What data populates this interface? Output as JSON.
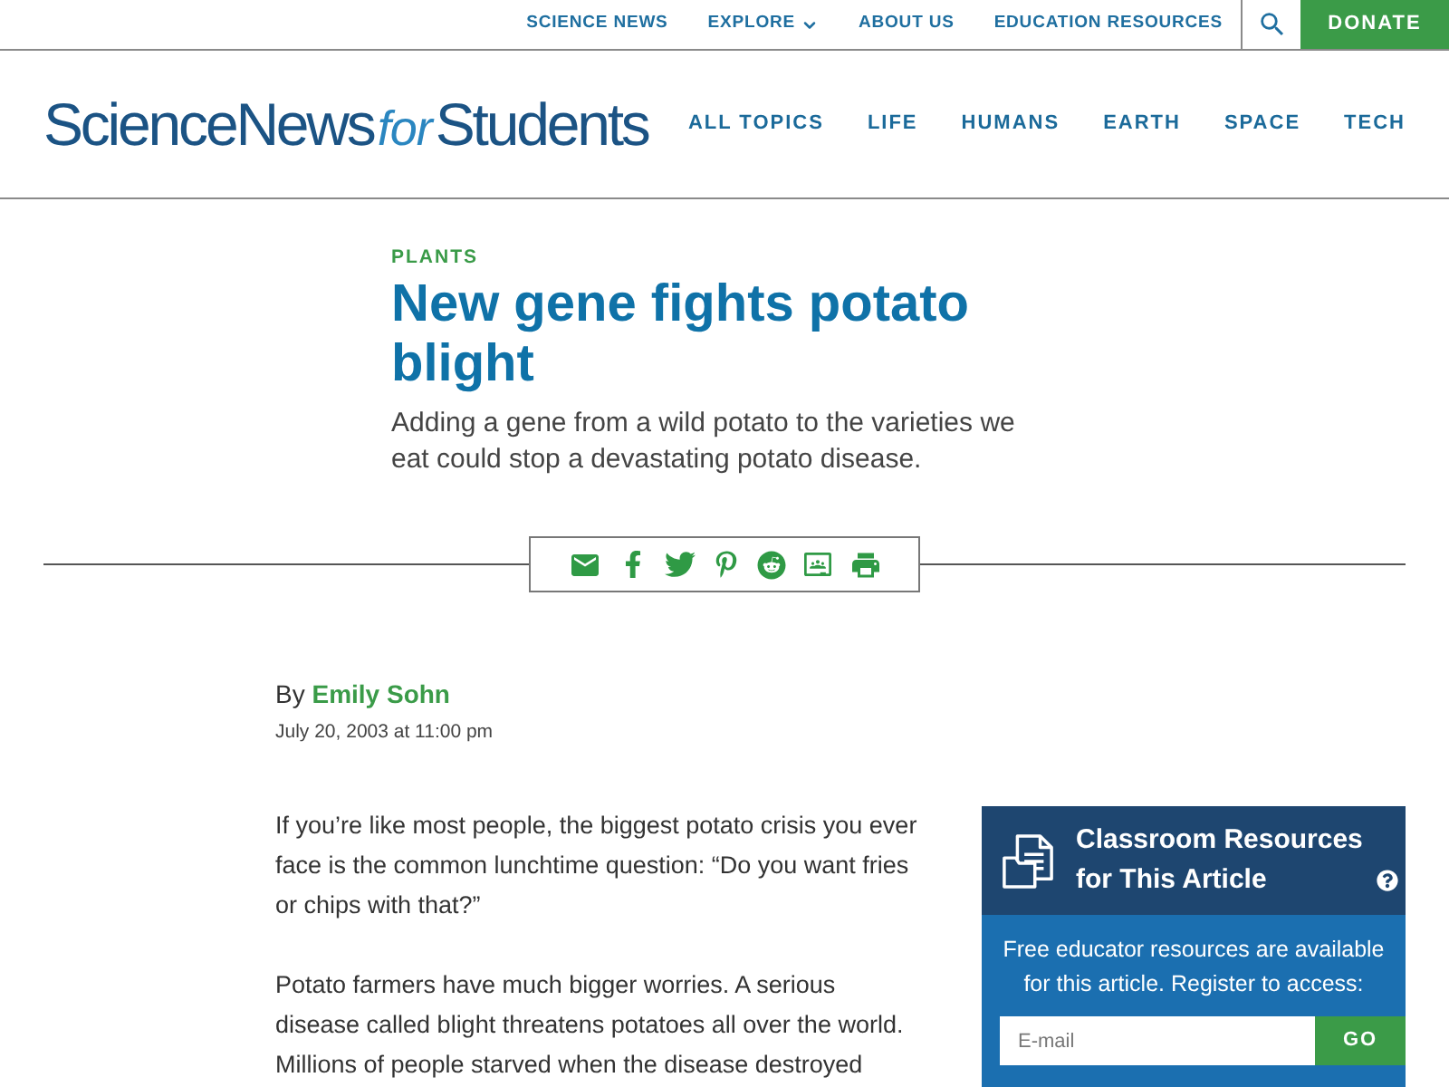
{
  "top_nav": {
    "links": [
      {
        "label": "SCIENCE NEWS",
        "kind": "link"
      },
      {
        "label": "EXPLORE",
        "kind": "dropdown"
      },
      {
        "label": "ABOUT US",
        "kind": "link"
      },
      {
        "label": "EDUCATION RESOURCES",
        "kind": "link"
      }
    ],
    "donate_button": "DONATE"
  },
  "header": {
    "logo": [
      {
        "text": "ScienceNews",
        "kind": "plain"
      },
      {
        "text": "for",
        "kind": "italic"
      },
      {
        "text": "Students",
        "kind": "plain"
      }
    ],
    "nav": [
      "ALL TOPICS",
      "LIFE",
      "HUMANS",
      "EARTH",
      "SPACE",
      "TECH"
    ]
  },
  "article": {
    "category": "PLANTS",
    "title": "New gene fights potato blight",
    "subtitle": "Adding a gene from a wild potato to the varieties we eat could stop a devastating potato disease.",
    "byline": {
      "prefix": "By",
      "author": "Emily Sohn"
    },
    "date": "July 20, 2003 at 11:00 pm",
    "paragraphs": [
      "If you’re like most people, the biggest potato crisis you ever face is the common lunchtime question: “Do you want fries or chips with that?”",
      "Potato farmers have much bigger worries. A serious disease called blight threatens potatoes all over the world. Millions of people starved when the disease destroyed"
    ]
  },
  "sidebar": {
    "title": "Classroom Resources for This Article",
    "description": "Free educator resources are available for this article. Register to access:",
    "email_field": {
      "placeholder": "E-mail"
    },
    "button": "GO"
  }
}
